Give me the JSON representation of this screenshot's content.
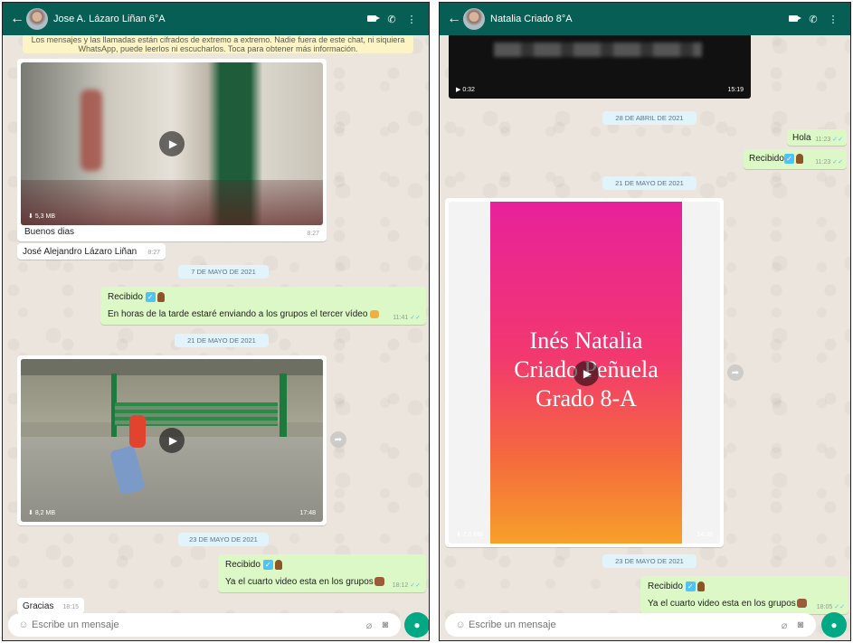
{
  "left": {
    "header": {
      "title": "Jose A. Lázaro Liñan 6°A"
    },
    "notice": {
      "line1": "Los mensajes y las llamadas están cifrados de extremo a extremo. Nadie fuera de este chat, ni siquiera",
      "line2": "WhatsApp, puede leerlos ni escucharlos. Toca para obtener más información."
    },
    "video1": {
      "size": "5,3 MB",
      "duration": "",
      "caption": "Buenos dias",
      "caption_time": "8:27"
    },
    "msg_name": {
      "text": "José Alejandro Lázaro Liñan",
      "time": "8:27"
    },
    "date1": "7 DE MAYO DE 2021",
    "out1": {
      "line1": "Recibido",
      "line2": "En horas de la tarde estaré enviando a los grupos el tercer vídeo",
      "time": "11:41"
    },
    "date2": "21 DE MAYO DE 2021",
    "video2": {
      "size": "8,2 MB",
      "duration": "17:48"
    },
    "date3": "23 DE MAYO DE 2021",
    "out2": {
      "line1": "Recibido",
      "line2": "Ya el cuarto video esta en los grupos",
      "time": "18:12"
    },
    "in_last": {
      "text": "Gracias",
      "time": "18:15"
    },
    "input": {
      "placeholder": "Escribe un mensaje"
    }
  },
  "right": {
    "header": {
      "title": "Natalia Criado 8°A"
    },
    "video_top": {
      "duration_left": "0:32",
      "time": "15:19"
    },
    "date1": "28 DE ABRIL DE 2021",
    "out_hola": {
      "text": "Hola",
      "time": "11:23"
    },
    "out_recibido": {
      "text": "Recibido",
      "time": "11:23"
    },
    "date2": "21 DE MAYO DE 2021",
    "video_big": {
      "line1": "Inés Natalia",
      "line2": "Criado Peñuela",
      "line3": "Grado 8-A",
      "size": "7,6 MB",
      "time": "14:36"
    },
    "date3": "23 DE MAYO DE 2021",
    "out2": {
      "line1": "Recibido",
      "line2": "Ya el cuarto video esta en los grupos",
      "time": "18:05"
    },
    "input": {
      "placeholder": "Escribe un mensaje"
    }
  },
  "colors": {
    "header": "#075e54",
    "outgoing": "#dcf8c6",
    "incoming": "#ffffff",
    "wallpaper": "#ece5dd",
    "date_chip": "#e1f3fb",
    "accent": "#00a884"
  },
  "icons": [
    "back-arrow-icon",
    "video-call-icon",
    "phone-icon",
    "menu-dots-icon",
    "play-icon",
    "download-icon",
    "forward-icon",
    "emoji-icon",
    "attach-icon",
    "camera-icon",
    "mic-icon"
  ]
}
